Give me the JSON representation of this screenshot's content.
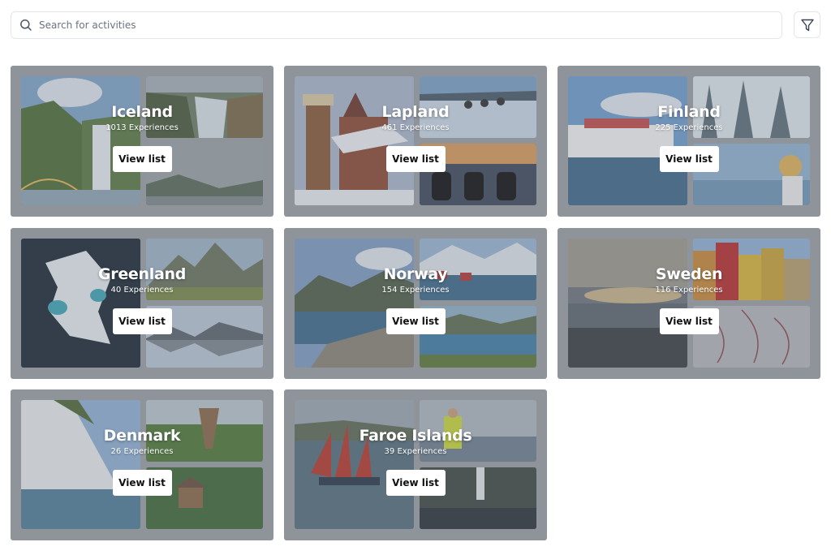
{
  "search": {
    "placeholder": "Search for activities",
    "icon": "search-icon"
  },
  "filter": {
    "icon": "filter-icon"
  },
  "button_label": "View list",
  "destinations": [
    {
      "name": "Iceland",
      "experiences": "1013 Experiences",
      "images": {
        "main": "waterfall-rainbow-photo",
        "top_right": "waterfall-canyon-photo",
        "bottom_right": "misty-fjord-photo"
      }
    },
    {
      "name": "Lapland",
      "experiences": "461 Experiences",
      "images": {
        "main": "snowy-village-tower-photo",
        "top_right": "husky-sled-photo",
        "bottom_right": "snowmobile-sunset-photo"
      }
    },
    {
      "name": "Finland",
      "experiences": "225 Experiences",
      "images": {
        "main": "ferry-boat-photo",
        "top_right": "snowy-forest-photo",
        "bottom_right": "woman-on-boat-photo"
      }
    },
    {
      "name": "Greenland",
      "experiences": "40 Experiences",
      "images": {
        "main": "iceberg-aerial-photo",
        "top_right": "mountain-peaks-photo",
        "bottom_right": "fjord-reflection-photo"
      }
    },
    {
      "name": "Norway",
      "experiences": "154 Experiences",
      "images": {
        "main": "lofoten-coast-photo",
        "top_right": "snowy-fishing-village-photo",
        "bottom_right": "harbor-village-photo"
      }
    },
    {
      "name": "Sweden",
      "experiences": "116 Experiences",
      "images": {
        "main": "beach-sunset-photo",
        "top_right": "colorful-houses-photo",
        "bottom_right": "ice-pattern-photo"
      }
    },
    {
      "name": "Denmark",
      "experiences": "26 Experiences",
      "images": {
        "main": "white-cliffs-photo",
        "top_right": "forest-tower-photo",
        "bottom_right": "treehouse-photo"
      }
    },
    {
      "name": "Faroe Islands",
      "experiences": "39 Experiences",
      "images": {
        "main": "red-sailboat-photo",
        "top_right": "sailor-on-mast-photo",
        "bottom_right": "coastal-waterfall-photo"
      }
    }
  ]
}
